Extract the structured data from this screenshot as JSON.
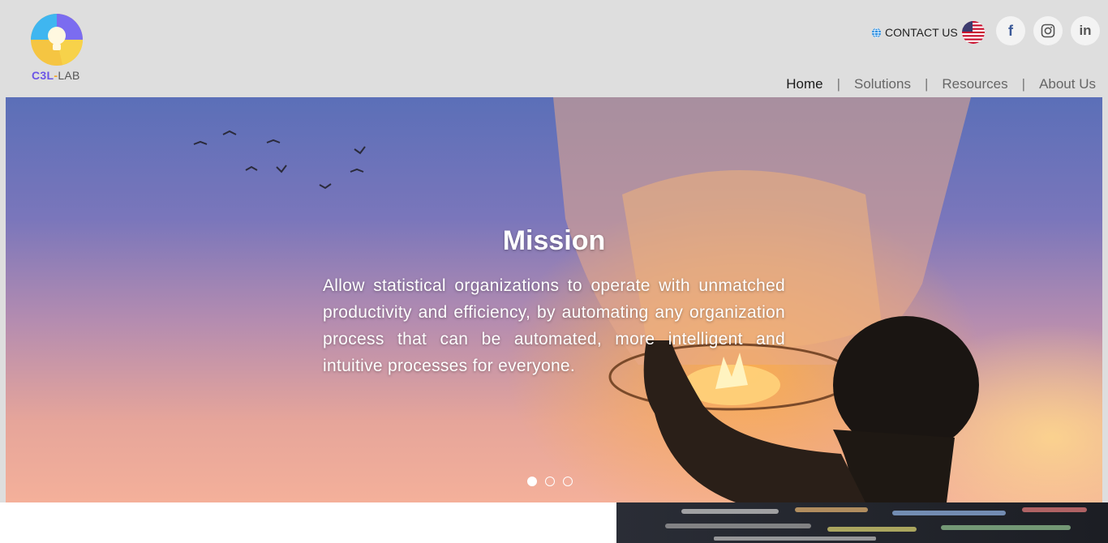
{
  "brand": {
    "logo_main": "C3L",
    "logo_dash": "-",
    "logo_sub": "LAB"
  },
  "topbar": {
    "contact_label": "CONTACT US",
    "globe_icon": "globe-icon",
    "flag_icon": "us-flag-icon"
  },
  "social": [
    {
      "name": "facebook-icon",
      "glyph": "f"
    },
    {
      "name": "instagram-icon",
      "glyph": ""
    },
    {
      "name": "linkedin-icon",
      "glyph": "in"
    }
  ],
  "nav": {
    "items": [
      {
        "label": "Home",
        "active": true
      },
      {
        "label": "Solutions",
        "active": false
      },
      {
        "label": "Resources",
        "active": false
      },
      {
        "label": "About Us",
        "active": false
      }
    ],
    "separator": "|"
  },
  "hero": {
    "title": "Mission",
    "text": "Allow statistical organizations to operate with unmatched productivity and efficiency, by automating any organization process that can be automated, more intelligent and intuitive processes for everyone.",
    "slides_total": 3,
    "active_slide": 1
  },
  "colors": {
    "brand_purple": "#6b55e6",
    "brand_yellow": "#f5c542",
    "brand_blue": "#3fb6f0",
    "facebook": "#3b5998"
  }
}
